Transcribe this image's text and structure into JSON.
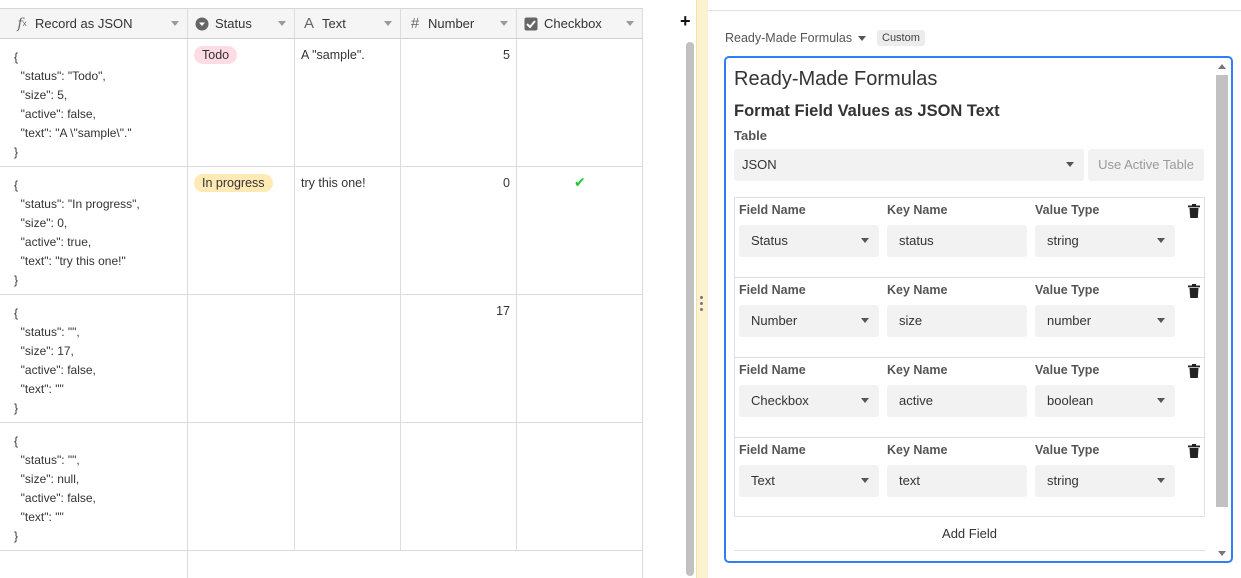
{
  "grid": {
    "columns": [
      {
        "label": "Record as JSON",
        "icon": "formula-icon"
      },
      {
        "label": "Status",
        "icon": "single-select-icon"
      },
      {
        "label": "Text",
        "icon": "text-icon"
      },
      {
        "label": "Number",
        "icon": "number-icon"
      },
      {
        "label": "Checkbox",
        "icon": "checkbox-icon"
      }
    ],
    "add_column_label": "+",
    "rows": [
      {
        "json": "{\n  \"status\": \"Todo\",\n  \"size\": 5,\n  \"active\": false,\n  \"text\": \"A \\\"sample\\\".\"\n}",
        "status": "Todo",
        "status_color": "#ffdce5",
        "text": "A \"sample\".",
        "number": "5",
        "checked": false
      },
      {
        "json": "{\n  \"status\": \"In progress\",\n  \"size\": 0,\n  \"active\": true,\n  \"text\": \"try this one!\"\n}",
        "status": "In progress",
        "status_color": "#ffeab6",
        "text": "try this one!",
        "number": "0",
        "checked": true,
        "check_glyph": "✔"
      },
      {
        "json": "{\n  \"status\": \"\",\n  \"size\": 17,\n  \"active\": false,\n  \"text\": \"\"\n}",
        "status": "",
        "text": "",
        "number": "17",
        "checked": false
      },
      {
        "json": "{\n  \"status\": \"\",\n  \"size\": null,\n  \"active\": false,\n  \"text\": \"\"\n}",
        "status": "",
        "text": "",
        "number": "",
        "checked": false
      }
    ]
  },
  "panel": {
    "extension_name": "Ready-Made Formulas",
    "badge": "Custom",
    "title": "Ready-Made Formulas",
    "subtitle": "Format Field Values as JSON Text",
    "table_label": "Table",
    "table_value": "JSON",
    "use_active_table": "Use Active Table",
    "labels": {
      "field_name": "Field Name",
      "key_name": "Key Name",
      "value_type": "Value Type"
    },
    "fields": [
      {
        "field": "Status",
        "key": "status",
        "type": "string"
      },
      {
        "field": "Number",
        "key": "size",
        "type": "number"
      },
      {
        "field": "Checkbox",
        "key": "active",
        "type": "boolean"
      },
      {
        "field": "Text",
        "key": "text",
        "type": "string"
      }
    ],
    "add_field": "Add Field"
  },
  "colors": {
    "accent": "#2d7ff9",
    "check": "#20c933",
    "divider": "#fdf2cf"
  }
}
